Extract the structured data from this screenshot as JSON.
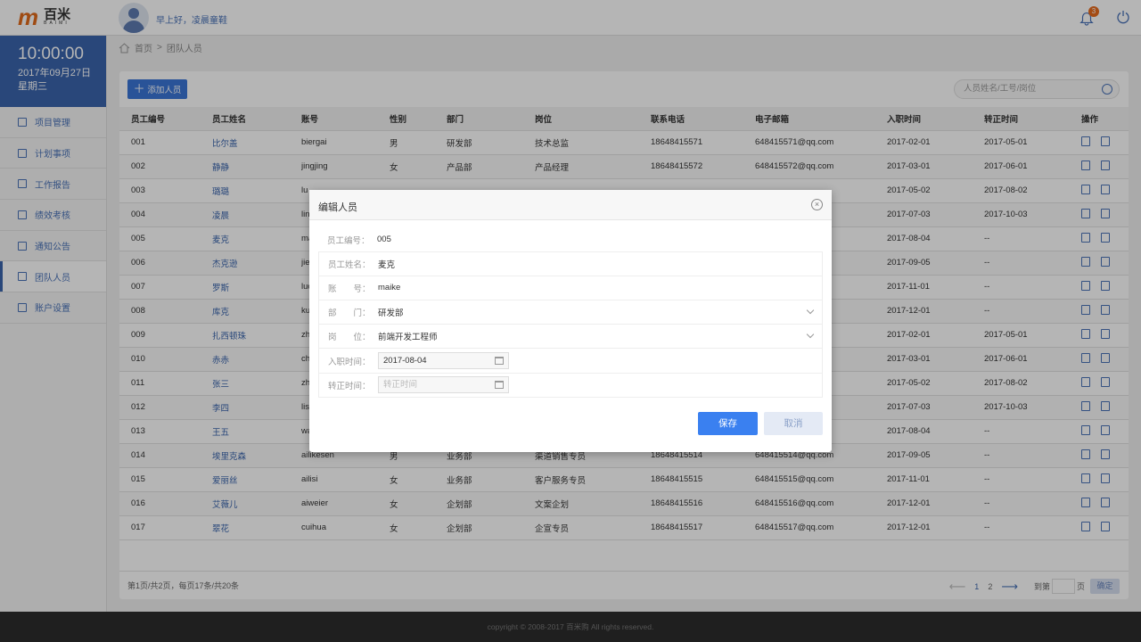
{
  "header": {
    "logo_text": "百米",
    "logo_sub": "BAIMI",
    "greeting": "早上好，凌晨童鞋",
    "notification_count": "3"
  },
  "sidebar": {
    "time": "10:00:00",
    "date": "2017年09月27日",
    "weekday": "星期三",
    "items": [
      {
        "label": "项目管理",
        "icon": "list-icon"
      },
      {
        "label": "计划事项",
        "icon": "plan-icon"
      },
      {
        "label": "工作报告",
        "icon": "report-icon"
      },
      {
        "label": "绩效考核",
        "icon": "edit-check-icon"
      },
      {
        "label": "通知公告",
        "icon": "notice-icon"
      },
      {
        "label": "团队人员",
        "icon": "team-icon",
        "active": true
      },
      {
        "label": "账户设置",
        "icon": "gear-icon"
      }
    ]
  },
  "breadcrumb": {
    "home": "首页",
    "sep": ">",
    "current": "团队人员"
  },
  "toolbar": {
    "add_label": "添加人员",
    "search_placeholder": "人员姓名/工号/岗位"
  },
  "table": {
    "headers": [
      "员工编号",
      "员工姓名",
      "账号",
      "性别",
      "部门",
      "岗位",
      "联系电话",
      "电子邮箱",
      "入职时间",
      "转正时间",
      "操作"
    ],
    "rows": [
      [
        "001",
        "比尔盖",
        "biergai",
        "男",
        "研发部",
        "技术总监",
        "18648415571",
        "648415571@qq.com",
        "2017-02-01",
        "2017-05-01"
      ],
      [
        "002",
        "静静",
        "jingjing",
        "女",
        "产品部",
        "产品经理",
        "18648415572",
        "648415572@qq.com",
        "2017-03-01",
        "2017-06-01"
      ],
      [
        "003",
        "璐璐",
        "lu",
        "",
        "",
        "",
        "",
        "",
        "2017-05-02",
        "2017-08-02"
      ],
      [
        "004",
        "凌晨",
        "lin",
        "",
        "",
        "",
        "",
        "",
        "2017-07-03",
        "2017-10-03"
      ],
      [
        "005",
        "麦克",
        "ma",
        "",
        "",
        "",
        "",
        "",
        "2017-08-04",
        "--"
      ],
      [
        "006",
        "杰克逊",
        "jie",
        "",
        "",
        "",
        "",
        "",
        "2017-09-05",
        "--"
      ],
      [
        "007",
        "罗斯",
        "luo",
        "",
        "",
        "",
        "",
        "",
        "2017-11-01",
        "--"
      ],
      [
        "008",
        "库克",
        "ku",
        "",
        "",
        "",
        "",
        "",
        "2017-12-01",
        "--"
      ],
      [
        "009",
        "扎西顿珠",
        "zh",
        "",
        "",
        "",
        "",
        "",
        "2017-02-01",
        "2017-05-01"
      ],
      [
        "010",
        "赤赤",
        "ch",
        "",
        "",
        "",
        "",
        "",
        "2017-03-01",
        "2017-06-01"
      ],
      [
        "011",
        "张三",
        "zh",
        "",
        "",
        "",
        "",
        "",
        "2017-05-02",
        "2017-08-02"
      ],
      [
        "012",
        "李四",
        "lis",
        "",
        "",
        "",
        "",
        "",
        "2017-07-03",
        "2017-10-03"
      ],
      [
        "013",
        "王五",
        "wa",
        "",
        "",
        "",
        "",
        "",
        "2017-08-04",
        "--"
      ],
      [
        "014",
        "埃里克森",
        "ailikesen",
        "男",
        "业务部",
        "渠道销售专员",
        "18648415514",
        "648415514@qq.com",
        "2017-09-05",
        "--"
      ],
      [
        "015",
        "爱丽丝",
        "ailisi",
        "女",
        "业务部",
        "客户服务专员",
        "18648415515",
        "648415515@qq.com",
        "2017-11-01",
        "--"
      ],
      [
        "016",
        "艾薇儿",
        "aiweier",
        "女",
        "企划部",
        "文案企划",
        "18648415516",
        "648415516@qq.com",
        "2017-12-01",
        "--"
      ],
      [
        "017",
        "翠花",
        "cuihua",
        "女",
        "企划部",
        "企宣专员",
        "18648415517",
        "648415517@qq.com",
        "2017-12-01",
        "--"
      ]
    ]
  },
  "pagination": {
    "summary": "第1页/共2页，每页17条/共20条",
    "pages": [
      "1",
      "2"
    ],
    "current": "1",
    "goto_label": "到第",
    "page_unit": "页",
    "confirm": "确定"
  },
  "footer": {
    "copyright": "copyright © 2008-2017 百米购 All rights reserved."
  },
  "modal": {
    "title": "编辑人员",
    "id_label": "员工编号：",
    "id_value": "005",
    "name_label": "员工姓名：",
    "name_value": "麦克",
    "account_label": "账　　号：",
    "account_value": "maike",
    "dept_label": "部　　门：",
    "dept_value": "研发部",
    "position_label": "岗　　位：",
    "position_value": "前端开发工程师",
    "join_label": "入职时间：",
    "join_value": "2017-08-04",
    "regular_label": "转正时间：",
    "regular_placeholder": "转正时间",
    "save": "保存",
    "cancel": "取消"
  },
  "colors": {
    "accent": "#3a65ad",
    "button": "#3a80f0",
    "badge": "#e76b1e",
    "logo": "#e06a1c"
  }
}
